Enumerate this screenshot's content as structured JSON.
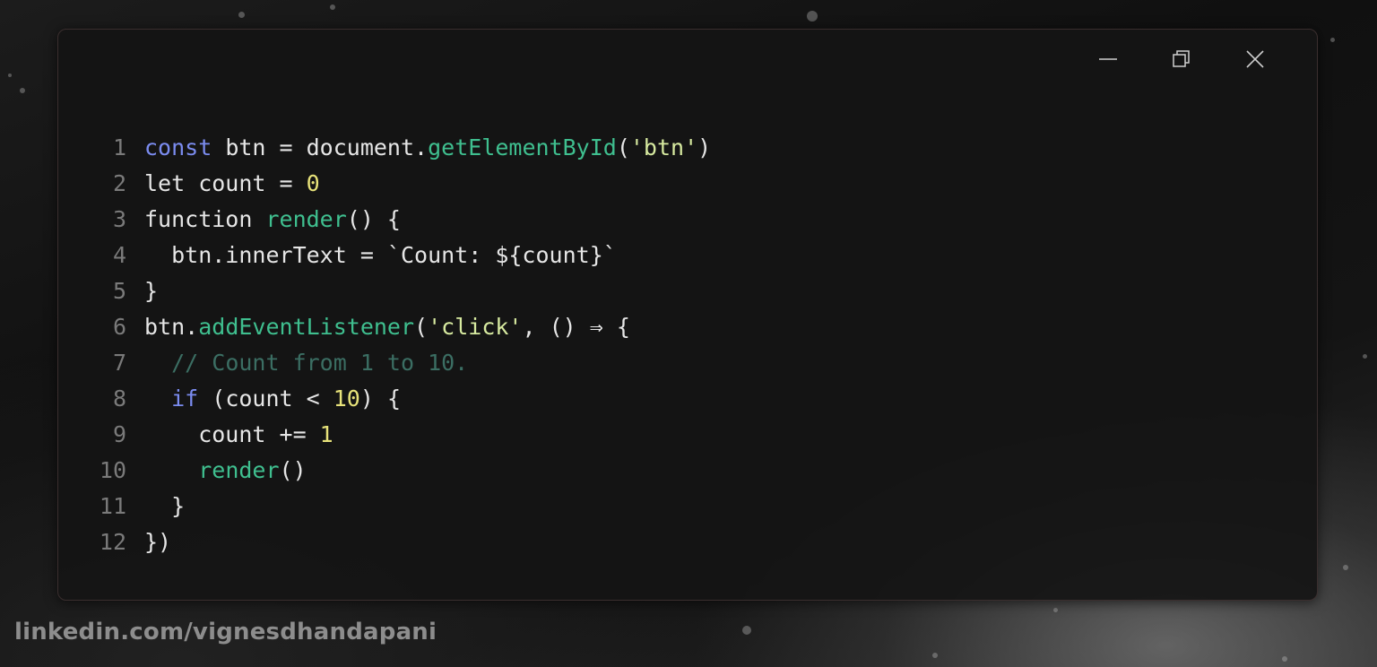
{
  "window": {
    "controls": {
      "minimize_icon": "minimize-icon",
      "restore_icon": "restore-icon",
      "close_icon": "close-icon"
    }
  },
  "code": {
    "lines": [
      {
        "n": "1",
        "tokens": [
          [
            "kw",
            "const"
          ],
          [
            "p",
            " btn = document."
          ],
          [
            "fn",
            "getElementById"
          ],
          [
            "p",
            "("
          ],
          [
            "str",
            "'btn'"
          ],
          [
            "p",
            ")"
          ]
        ]
      },
      {
        "n": "2",
        "tokens": [
          [
            "p",
            "let count = "
          ],
          [
            "num",
            "0"
          ]
        ]
      },
      {
        "n": "3",
        "tokens": [
          [
            "p",
            "function "
          ],
          [
            "fn",
            "render"
          ],
          [
            "p",
            "() {"
          ]
        ]
      },
      {
        "n": "4",
        "tokens": [
          [
            "p",
            "  btn.innerText = `Count: ${count}`"
          ]
        ]
      },
      {
        "n": "5",
        "tokens": [
          [
            "p",
            "}"
          ]
        ]
      },
      {
        "n": "6",
        "tokens": [
          [
            "p",
            "btn."
          ],
          [
            "fn",
            "addEventListener"
          ],
          [
            "p",
            "("
          ],
          [
            "str",
            "'click'"
          ],
          [
            "p",
            ", () ⇒ {"
          ]
        ]
      },
      {
        "n": "7",
        "tokens": [
          [
            "p",
            "  "
          ],
          [
            "cmt",
            "// Count from 1 to 10."
          ]
        ]
      },
      {
        "n": "8",
        "tokens": [
          [
            "p",
            "  "
          ],
          [
            "kw",
            "if"
          ],
          [
            "p",
            " (count < "
          ],
          [
            "num",
            "10"
          ],
          [
            "p",
            ") {"
          ]
        ]
      },
      {
        "n": "9",
        "tokens": [
          [
            "p",
            "    count += "
          ],
          [
            "num",
            "1"
          ]
        ]
      },
      {
        "n": "10",
        "tokens": [
          [
            "p",
            "    "
          ],
          [
            "fn",
            "render"
          ],
          [
            "p",
            "()"
          ]
        ]
      },
      {
        "n": "11",
        "tokens": [
          [
            "p",
            "  }"
          ]
        ]
      },
      {
        "n": "12",
        "tokens": [
          [
            "p",
            "})"
          ]
        ]
      }
    ]
  },
  "colors": {
    "keyword": "#7b8cf0",
    "function": "#3fbf8f",
    "string": "#d7eaa0",
    "number": "#e7e27a",
    "comment": "#3b6e63",
    "text": "#e6e6e6",
    "line_number": "#7a7a7a"
  },
  "watermark": {
    "text": "linkedin.com/vignesdhandapani"
  }
}
